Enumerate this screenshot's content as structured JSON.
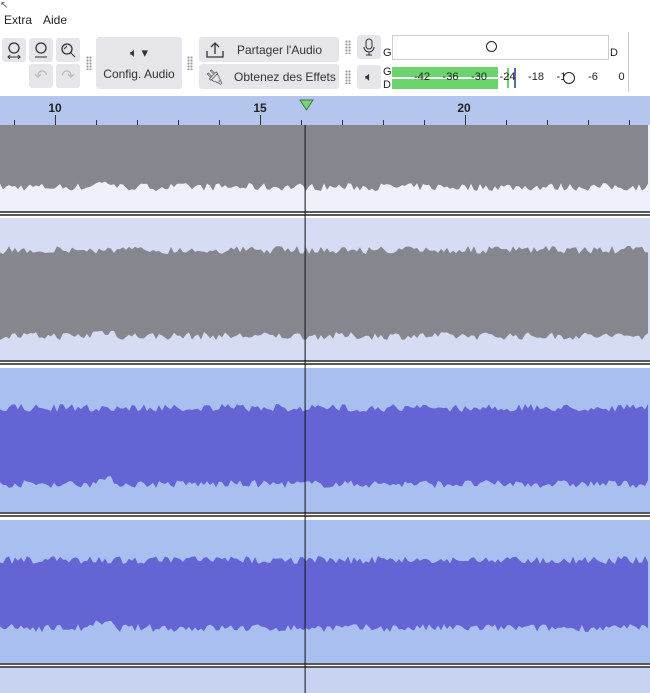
{
  "menu": {
    "items": [
      "Extra",
      "Aide"
    ]
  },
  "toolbar": {
    "audio_setup_label": "Config. Audio",
    "share_audio_label": "Partager l'Audio",
    "get_effects_label": "Obtenez des Effets"
  },
  "meters": {
    "record": {
      "left_label": "G",
      "right_label": "D"
    },
    "playback": {
      "left_label": "G",
      "right_label": "D",
      "scale": [
        "-42",
        "-36",
        "-30",
        "-24",
        "-18",
        "-12",
        "-6",
        "0"
      ],
      "level_fraction": 0.47
    }
  },
  "ruler": {
    "labels": [
      "10",
      "15",
      "20"
    ],
    "label_seconds": [
      10,
      15,
      20
    ],
    "playhead_seconds": 16.1
  },
  "colors": {
    "gray_wave": "#86868e",
    "blue_wave": "#6464d4",
    "blue_bg": "#a8bff0",
    "meter_green": "#6cd46c"
  }
}
